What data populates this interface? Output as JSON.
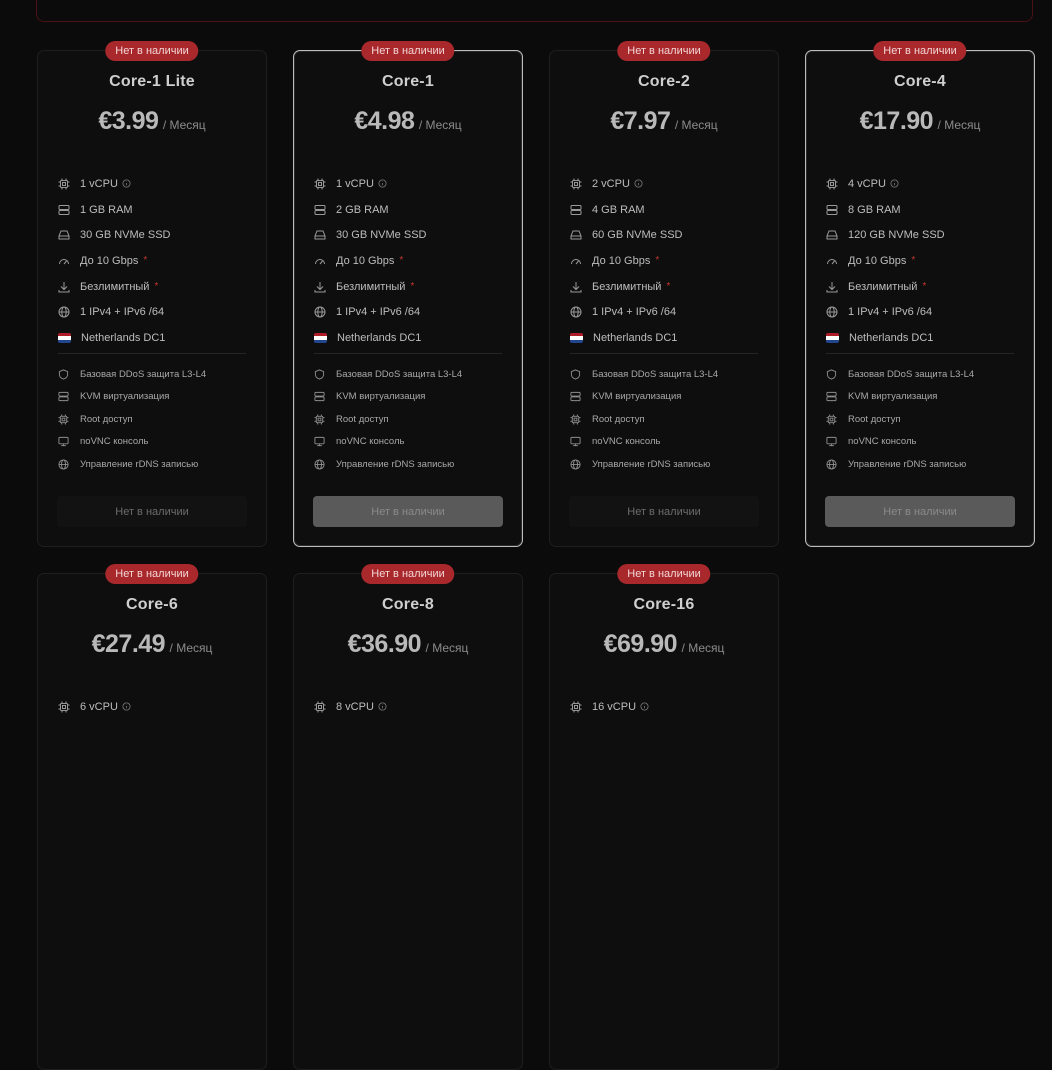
{
  "common": {
    "badge": "Нет в наличии",
    "per": "/ Месяц",
    "button": "Нет в наличии",
    "bandwidth": "До 10 Gbps",
    "traffic": "Безлимитный",
    "ips": "1 IPv4 + IPv6 /64",
    "location": "Netherlands DC1",
    "features": [
      "Базовая DDoS защита L3-L4",
      "KVM виртуализация",
      "Root доступ",
      "noVNC консоль",
      "Управление rDNS записью"
    ]
  },
  "plans": [
    {
      "name": "Core-1 Lite",
      "price": "€3.99",
      "cpu": "1 vCPU",
      "ram": "1 GB RAM",
      "disk": "30 GB NVMe SSD"
    },
    {
      "name": "Core-1",
      "price": "€4.98",
      "cpu": "1 vCPU",
      "ram": "2 GB RAM",
      "disk": "30 GB NVMe SSD"
    },
    {
      "name": "Core-2",
      "price": "€7.97",
      "cpu": "2 vCPU",
      "ram": "4 GB RAM",
      "disk": "60 GB NVMe SSD"
    },
    {
      "name": "Core-4",
      "price": "€17.90",
      "cpu": "4 vCPU",
      "ram": "8 GB RAM",
      "disk": "120 GB NVMe SSD"
    },
    {
      "name": "Core-6",
      "price": "€27.49",
      "cpu": "6 vCPU"
    },
    {
      "name": "Core-8",
      "price": "€36.90",
      "cpu": "8 vCPU"
    },
    {
      "name": "Core-16",
      "price": "€69.90",
      "cpu": "16 vCPU"
    }
  ],
  "colors": {
    "badge": "#a8282b",
    "flag": [
      "#ae1c28",
      "#ffffff",
      "#21468b"
    ]
  }
}
